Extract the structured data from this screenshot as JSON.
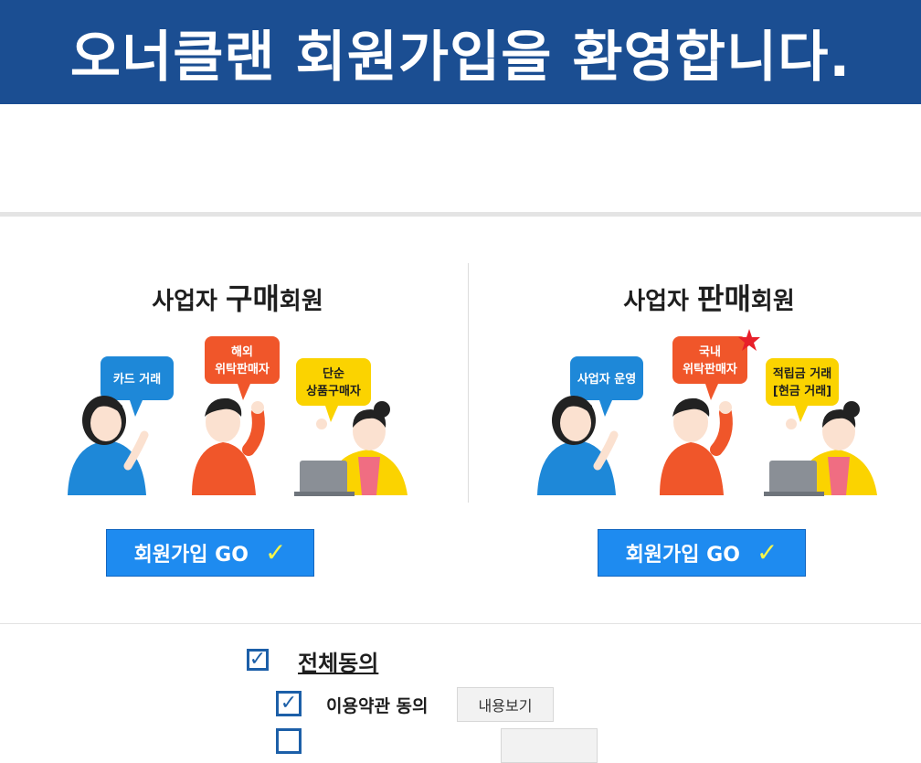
{
  "banner": {
    "title": "오너클랜 회원가입을 환영합니다."
  },
  "buyer": {
    "heading_prefix": "사업자 ",
    "heading_highlight": "구매",
    "heading_suffix": "회원",
    "bubbles": {
      "card": "카드 거래",
      "overseas_line1": "해외",
      "overseas_line2": "위탁판매자",
      "simple_line1": "단순",
      "simple_line2": "상품구매자"
    },
    "go_label": "회원가입 GO"
  },
  "seller": {
    "heading_prefix": "사업자 ",
    "heading_highlight": "판매",
    "heading_suffix": "회원",
    "bubbles": {
      "operator": "사업자 운영",
      "domestic_line1": "국내",
      "domestic_line2": "위탁판매자",
      "credit_line1": "적립금 거래",
      "credit_line2": "[현금 거래]"
    },
    "go_label": "회원가입 GO"
  },
  "agreements": {
    "all_label": "전체동의",
    "all_checked": true,
    "terms_label": "이용약관 동의",
    "terms_checked": true,
    "view_label": "내용보기"
  },
  "colors": {
    "banner_bg": "#1b4e92",
    "go_button": "#1e8bf0",
    "checkbox": "#1c5fa8"
  },
  "icons": {
    "go_check": "✓",
    "checkbox_check": "✓"
  }
}
